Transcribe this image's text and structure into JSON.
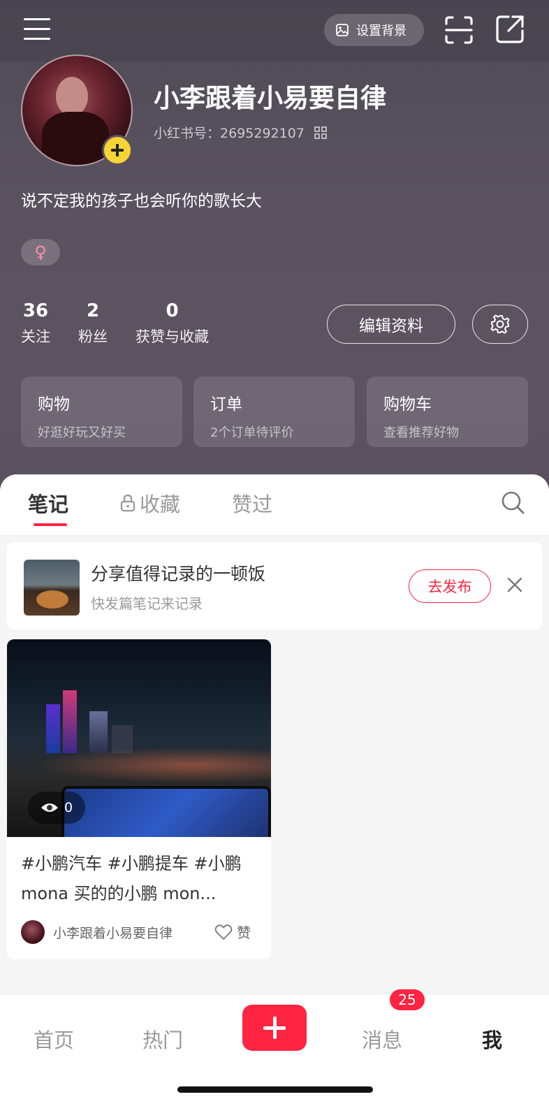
{
  "header": {
    "set_background_label": "设置背景",
    "nickname": "小李跟着小易要自律",
    "red_id": "小红书号：2695292107",
    "bio": "说不定我的孩子也会听你的歌长大",
    "gender_symbol": "♀",
    "stats": [
      {
        "value": "36",
        "label": "关注"
      },
      {
        "value": "2",
        "label": "粉丝"
      },
      {
        "value": "0",
        "label": "获赞与收藏"
      }
    ],
    "edit_profile_label": "编辑资料",
    "cards": [
      {
        "title": "购物",
        "subtitle": "好逛好玩又好买"
      },
      {
        "title": "订单",
        "subtitle": "2个订单待评价"
      },
      {
        "title": "购物车",
        "subtitle": "查看推荐好物"
      }
    ]
  },
  "tabs": [
    {
      "label": "笔记",
      "active": true
    },
    {
      "label": "收藏",
      "locked": true
    },
    {
      "label": "赞过"
    }
  ],
  "promo": {
    "title": "分享值得记录的一顿饭",
    "subtitle": "快发篇笔记来记录",
    "button_label": "去发布"
  },
  "notes": [
    {
      "views": "0",
      "title": "#小鹏汽车 #小鹏提车 #小鹏 mona 买的的小鹏 mon...",
      "author": "小李跟着小易要自律",
      "like_label": "赞"
    }
  ],
  "bottom_nav": {
    "items": [
      {
        "label": "首页"
      },
      {
        "label": "热门"
      },
      {
        "label": "消息",
        "badge": "25"
      },
      {
        "label": "我",
        "active": true
      }
    ]
  },
  "colors": {
    "accent": "#ff2442",
    "header_bg": "#5a5160",
    "add_badge": "#f5d536"
  }
}
